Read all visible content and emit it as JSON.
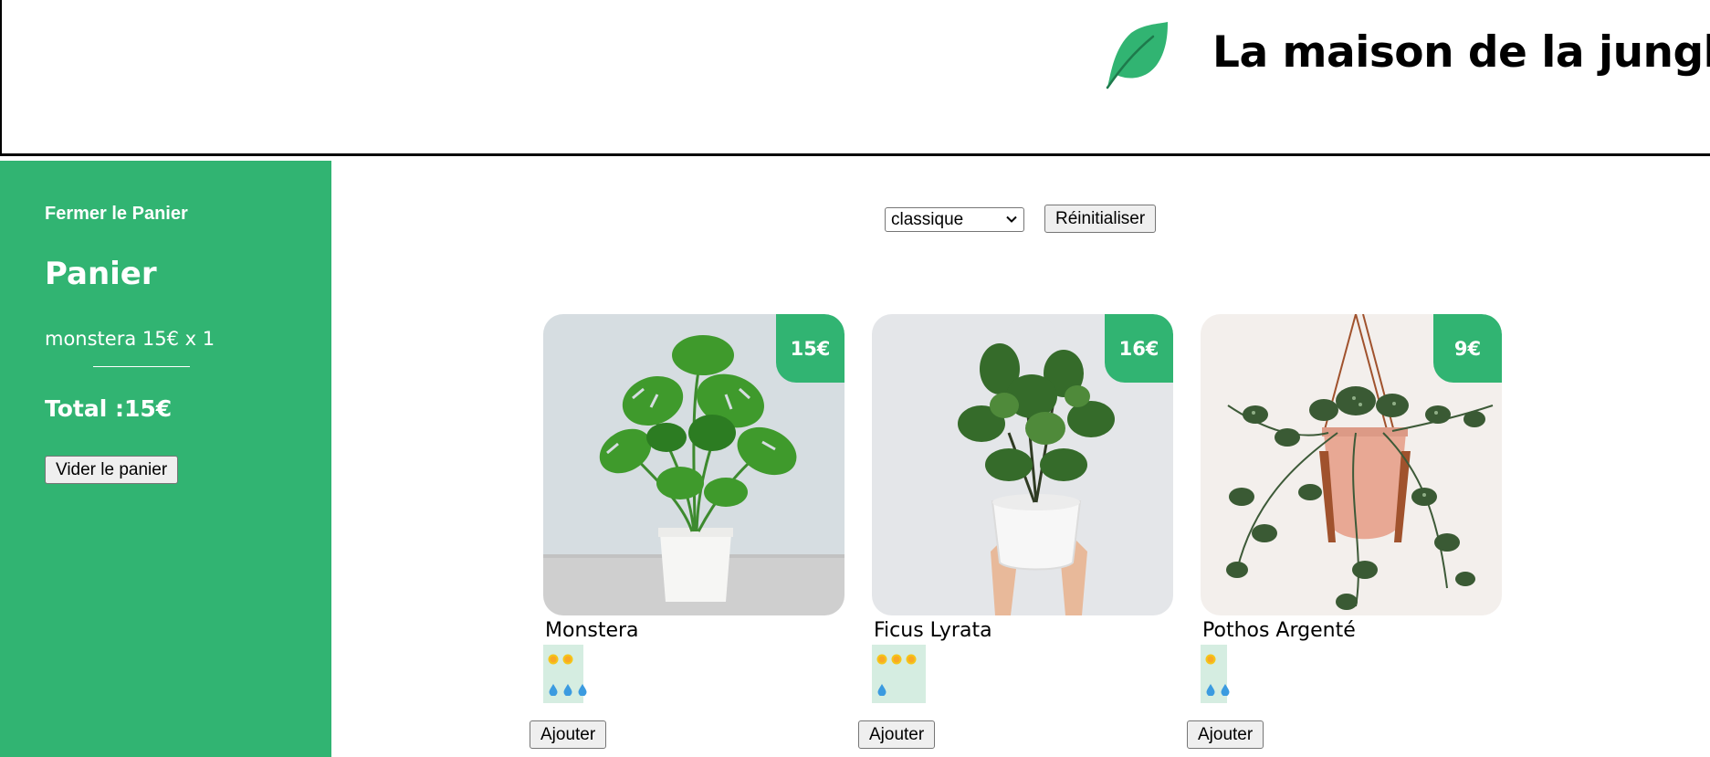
{
  "header": {
    "title": "La maison de la jungle",
    "logo_icon": "leaf-icon",
    "brand_color": "#31b472"
  },
  "cart": {
    "close_label": "Fermer le Panier",
    "title": "Panier",
    "items": [
      {
        "text": "monstera 15€ x 1"
      }
    ],
    "total": "Total :15€",
    "clear_label": "Vider le panier"
  },
  "filters": {
    "category_selected": "classique",
    "reset_label": "Réinitialiser"
  },
  "plants": [
    {
      "name": "Monstera",
      "price": "15€",
      "light": 2,
      "water": 3,
      "add_label": "Ajouter"
    },
    {
      "name": "Ficus Lyrata",
      "price": "16€",
      "light": 3,
      "water": 1,
      "add_label": "Ajouter"
    },
    {
      "name": "Pothos Argenté",
      "price": "9€",
      "light": 1,
      "water": 2,
      "add_label": "Ajouter"
    }
  ],
  "icons": {
    "light": "sun-icon",
    "water": "water-drop-icon",
    "select": "chevron-down-icon"
  }
}
